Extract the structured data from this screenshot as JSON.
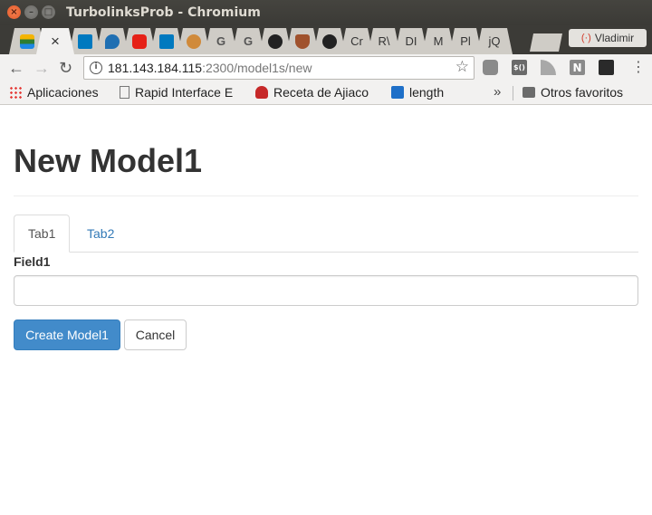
{
  "window": {
    "title": "TurbolinksProb - Chromium",
    "profile_name": "Vladimir"
  },
  "tabs": [
    {
      "favicon": "stack-icon",
      "color": "#2e7d32",
      "active": false
    },
    {
      "favicon": "close-icon",
      "color": "#444444",
      "active": true,
      "close": "×"
    },
    {
      "favicon": "trello-icon",
      "color": "#0079bf",
      "active": false
    },
    {
      "favicon": "drop-icon",
      "color": "#1f6fb2",
      "active": false
    },
    {
      "favicon": "youtube-icon",
      "color": "#e62117",
      "active": false
    },
    {
      "favicon": "trello-icon",
      "color": "#0079bf",
      "active": false
    },
    {
      "favicon": "cat-icon",
      "color": "#d08a3a",
      "active": false
    },
    {
      "favicon": "g-icon",
      "color": "#555555",
      "active": false
    },
    {
      "favicon": "g-icon",
      "color": "#555555",
      "active": false
    },
    {
      "favicon": "github-icon",
      "color": "#222222",
      "active": false
    },
    {
      "favicon": "badger-icon",
      "color": "#a0522d",
      "active": false
    },
    {
      "favicon": "github-icon",
      "color": "#222222",
      "active": false
    },
    {
      "label": "Cr",
      "active": false
    },
    {
      "label": "R\\",
      "active": false
    },
    {
      "label": "DI",
      "active": false
    },
    {
      "label": "M",
      "active": false
    },
    {
      "label": "Pl",
      "active": false
    },
    {
      "label": "jQ",
      "active": false
    }
  ],
  "toolbar": {
    "back": "←",
    "forward": "→",
    "reload": "↻",
    "url_host": "181.143.184.115",
    "url_path": ":2300/model1s/new",
    "star": "☆"
  },
  "bookmarks": {
    "apps": "Aplicaciones",
    "items": [
      "Rapid Interface E",
      "Receta de Ajiaco",
      "length"
    ],
    "overflow": "»",
    "other": "Otros favoritos"
  },
  "page": {
    "heading": "New Model1",
    "tabs": [
      "Tab1",
      "Tab2"
    ],
    "field_label": "Field1",
    "field_value": "",
    "submit_label": "Create Model1",
    "cancel_label": "Cancel"
  },
  "colors": {
    "primary": "#428bca",
    "link": "#337ab7",
    "titlebar": "#3b3a36"
  }
}
